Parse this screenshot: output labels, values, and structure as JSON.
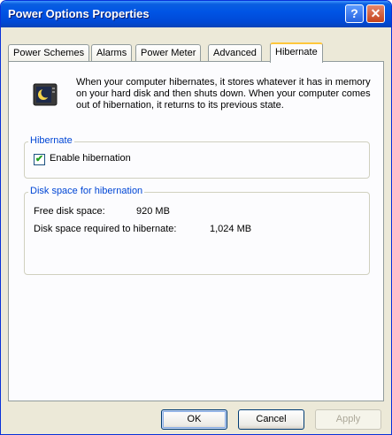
{
  "window": {
    "title": "Power Options Properties",
    "help_label": "?",
    "close_label": "✕"
  },
  "tabs": [
    {
      "label": "Power Schemes"
    },
    {
      "label": "Alarms"
    },
    {
      "label": "Power Meter"
    },
    {
      "label": "Advanced"
    },
    {
      "label": "Hibernate",
      "active": true
    }
  ],
  "intro_text": "When your computer hibernates, it stores whatever it has in memory on your hard disk and then shuts down. When your computer comes out of hibernation, it returns to its previous state.",
  "hibernate_group": {
    "title": "Hibernate",
    "checkbox_label": "Enable hibernation",
    "checkbox_mark": "✔",
    "checked": true
  },
  "disk_group": {
    "title": "Disk space for hibernation",
    "free_label": "Free disk space:",
    "free_value": "920 MB",
    "required_label": "Disk space required to hibernate:",
    "required_value": "1,024 MB"
  },
  "buttons": {
    "ok": "OK",
    "cancel": "Cancel",
    "apply": "Apply"
  },
  "colors": {
    "titlebar": "#0055e5",
    "group_title": "#0046d5",
    "tab_highlight": "#ffc73c"
  },
  "icons": {
    "hibernate": "moon-monitor-icon",
    "help": "help-icon",
    "close": "close-icon"
  }
}
